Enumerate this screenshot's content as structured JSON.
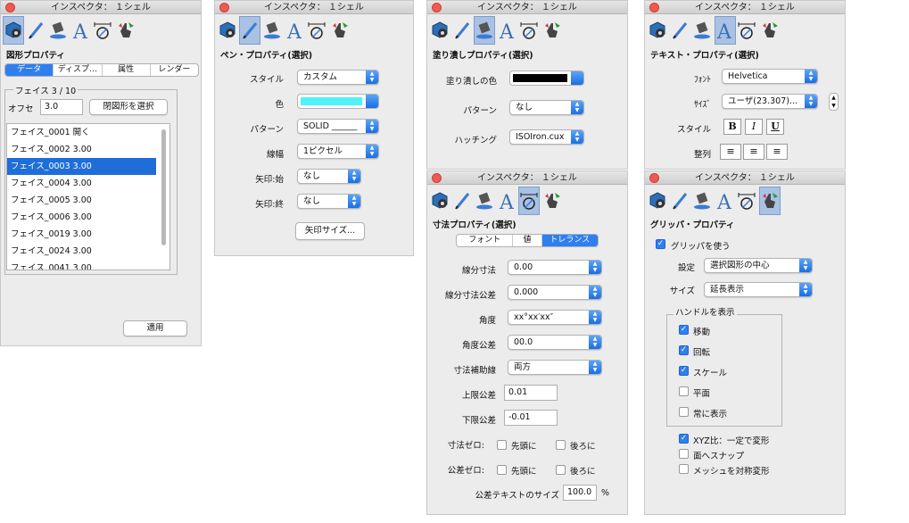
{
  "panel1": {
    "title": "インスペクタ： １シェル",
    "section": "図形プロパティ",
    "tabs": [
      "データ",
      "ディスプ…",
      "属性",
      "レンダー"
    ],
    "face_group": "フェイス 3 / 10",
    "offset_label": "オフセ",
    "offset_value": "3.0",
    "select_button": "閉図形を選択",
    "faces": [
      "フェイス_0001 開く",
      "フェイス_0002 3.00",
      "フェイス_0003 3.00",
      "フェイス_0004 3.00",
      "フェイス_0005 3.00",
      "フェイス_0006 3.00",
      "フェイス_0019 3.00",
      "フェイス_0024 3.00",
      "フェイス_0041 3.00"
    ],
    "apply": "適用"
  },
  "panel2": {
    "title": "インスペクタ： １シェル",
    "section": "ペン・プロパティ(選択)",
    "style_label": "スタイル",
    "style_value": "カスタム",
    "color_label": "色",
    "color_value": "#4ef2f8",
    "pattern_label": "パターン",
    "pattern_value": "SOLID ______",
    "width_label": "線幅",
    "width_value": "1ピクセル",
    "arrow_start_label": "矢印:始",
    "arrow_start_value": "なし",
    "arrow_end_label": "矢印:終",
    "arrow_end_value": "なし",
    "arrow_size_button": "矢印サイズ..."
  },
  "panel3": {
    "title": "インスペクタ： １シェル",
    "section": "塗り潰しプロパティ(選択)",
    "fill_color_label": "塗り潰しの色",
    "fill_color_value": "#000000",
    "pattern_label": "パターン",
    "pattern_value": "なし",
    "hatch_label": "ハッチング",
    "hatch_value": "ISOIron.cux"
  },
  "panel4": {
    "title": "インスペクタ： １シェル",
    "section": "テキスト・プロパティ(選択)",
    "font_label": "ﾌｫﾝﾄ",
    "font_value": "Helvetica",
    "size_label": "ｻｲｽﾞ",
    "size_value": "ユーザ(23.307)...",
    "style_label": "スタイル",
    "style_buttons": [
      "B",
      "I",
      "U"
    ],
    "align_label": "整列"
  },
  "panel5": {
    "title": "インスペクタ： １シェル",
    "section": "寸法プロパティ(選択)",
    "tabs": [
      "フォント",
      "値",
      "トレランス"
    ],
    "line_dim_label": "線分寸法",
    "line_dim_value": "0.00",
    "line_tol_label": "線分寸法公差",
    "line_tol_value": "0.000",
    "angle_label": "角度",
    "angle_value": "xx°xx′xx″",
    "angle_tol_label": "角度公差",
    "angle_tol_value": "00.0",
    "ext_label": "寸法補助線",
    "ext_value": "両方",
    "upper_label": "上限公差",
    "upper_value": "0.01",
    "lower_label": "下限公差",
    "lower_value": "-0.01",
    "dim_zero_label": "寸法ゼロ:",
    "tol_zero_label": "公差ゼロ:",
    "leading": "先頭に",
    "trailing": "後ろに",
    "tol_text_label": "公差テキストのサイズ",
    "tol_text_value": "100.0",
    "tol_text_unit": "%"
  },
  "panel6": {
    "title": "インスペクタ： １シェル",
    "section": "グリッパ・プロパティ",
    "use_gripper": "グリッパを使う",
    "setting_label": "設定",
    "setting_value": "選択図形の中心",
    "size_label": "サイズ",
    "size_value": "延長表示",
    "handles_group": "ハンドルを表示",
    "handles": [
      {
        "label": "移動",
        "checked": true
      },
      {
        "label": "回転",
        "checked": true
      },
      {
        "label": "スケール",
        "checked": true
      },
      {
        "label": "平面",
        "checked": false
      },
      {
        "label": "常に表示",
        "checked": false
      }
    ],
    "options": [
      {
        "label": "XYZ比：一定で変形",
        "checked": true
      },
      {
        "label": "面へスナップ",
        "checked": false
      },
      {
        "label": "メッシュを対称変形",
        "checked": false
      }
    ]
  },
  "colors": {
    "accent": "#2f7ff0",
    "selection": "#1f6ed8",
    "close": "#ee5a52"
  },
  "toolbar_icons": [
    "shape-gear-icon",
    "pen-icon",
    "fill-bucket-icon",
    "text-a-icon",
    "dimension-icon",
    "gripper-hand-icon"
  ]
}
